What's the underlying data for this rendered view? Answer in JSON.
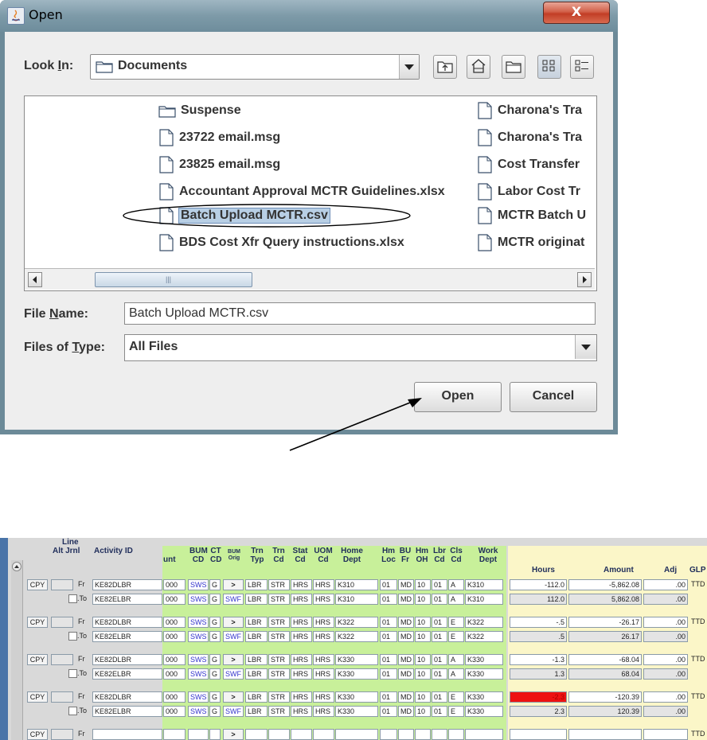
{
  "dialog": {
    "title": "Open",
    "close_label": "X",
    "look_in_label_pre": "Look ",
    "look_in_label_u": "I",
    "look_in_label_post": "n:",
    "look_in_value": "Documents",
    "files_left": [
      "Suspense",
      "23722 email.msg",
      "23825 email.msg",
      "Accountant Approval MCTR Guidelines.xlsx",
      "Batch Upload MCTR.csv",
      "BDS Cost Xfr Query instructions.xlsx"
    ],
    "files_right": [
      "Charona's Tra",
      "Charona's Tra",
      "Cost Transfer",
      "Labor Cost Tr",
      "MCTR Batch U",
      "MCTR originat"
    ],
    "file_name_label_pre": "File ",
    "file_name_label_u": "N",
    "file_name_label_post": "ame:",
    "file_name_value": "Batch Upload MCTR.csv",
    "files_type_label_pre": "Files of ",
    "files_type_label_u": "T",
    "files_type_label_post": "ype:",
    "files_type_value": "All Files",
    "open_label": "Open",
    "cancel_label": "Cancel",
    "scroll_thumb_mark": "|||"
  },
  "grid": {
    "headers": {
      "line": "Line",
      "alt_jrnl": "Alt Jrnl",
      "activity_id": "Activity ID",
      "unt": "unt",
      "bum_cd": [
        "BUM",
        "CD"
      ],
      "ct_cd": [
        "CT",
        "CD"
      ],
      "bum_orig": [
        "BUM",
        "Orig"
      ],
      "trn_typ": [
        "Trn",
        "Typ"
      ],
      "trn_cd": [
        "Trn",
        "Cd"
      ],
      "stat_cd": [
        "Stat",
        "Cd"
      ],
      "uom_cd": [
        "UOM",
        "Cd"
      ],
      "home_dept": [
        "Home",
        "Dept"
      ],
      "hm_loc": [
        "Hm",
        "Loc"
      ],
      "bu_fr": [
        "BU",
        "Fr"
      ],
      "hm_oh": [
        "Hm",
        "OH"
      ],
      "lbr_cd": [
        "Lbr",
        "Cd"
      ],
      "cls_cd": [
        "Cls",
        "Cd"
      ],
      "work_dept": [
        "Work",
        "Dept"
      ],
      "hours": "Hours",
      "amount": "Amount",
      "adj": "Adj",
      "glp": "GLP"
    },
    "cpy_label": "CPY",
    "fr_label": "Fr",
    "to_label": ".To",
    "btn_arrow": ">",
    "rows": [
      {
        "activity": "KE82DLBR",
        "unt": "000",
        "bum": "SWS",
        "ct": "G",
        "orig": ">",
        "typ": "LBR",
        "trn": "STR",
        "stat": "HRS",
        "uom": "HRS",
        "home": "K310",
        "loc": "01",
        "bu": "MD",
        "oh": "10",
        "lbr": "01",
        "cls": "A",
        "work": "K310",
        "hours": "-112.0",
        "amount": "-5,862.08",
        "adj": ".00",
        "glp": "TTD"
      },
      {
        "activity": "KE82ELBR",
        "unt": "000",
        "bum": "SWS",
        "ct": "G",
        "orig": "SWF",
        "typ": "LBR",
        "trn": "STR",
        "stat": "HRS",
        "uom": "HRS",
        "home": "K310",
        "loc": "01",
        "bu": "MD",
        "oh": "10",
        "lbr": "01",
        "cls": "A",
        "work": "K310",
        "hours": "112.0",
        "amount": "5,862.08",
        "adj": ".00",
        "glp": ""
      },
      {
        "activity": "KE82DLBR",
        "unt": "000",
        "bum": "SWS",
        "ct": "G",
        "orig": ">",
        "typ": "LBR",
        "trn": "STR",
        "stat": "HRS",
        "uom": "HRS",
        "home": "K322",
        "loc": "01",
        "bu": "MD",
        "oh": "10",
        "lbr": "01",
        "cls": "E",
        "work": "K322",
        "hours": "-.5",
        "amount": "-26.17",
        "adj": ".00",
        "glp": "TTD"
      },
      {
        "activity": "KE82ELBR",
        "unt": "000",
        "bum": "SWS",
        "ct": "G",
        "orig": "SWF",
        "typ": "LBR",
        "trn": "STR",
        "stat": "HRS",
        "uom": "HRS",
        "home": "K322",
        "loc": "01",
        "bu": "MD",
        "oh": "10",
        "lbr": "01",
        "cls": "E",
        "work": "K322",
        "hours": ".5",
        "amount": "26.17",
        "adj": ".00",
        "glp": ""
      },
      {
        "activity": "KE82DLBR",
        "unt": "000",
        "bum": "SWS",
        "ct": "G",
        "orig": ">",
        "typ": "LBR",
        "trn": "STR",
        "stat": "HRS",
        "uom": "HRS",
        "home": "K330",
        "loc": "01",
        "bu": "MD",
        "oh": "10",
        "lbr": "01",
        "cls": "A",
        "work": "K330",
        "hours": "-1.3",
        "amount": "-68.04",
        "adj": ".00",
        "glp": "TTD"
      },
      {
        "activity": "KE82ELBR",
        "unt": "000",
        "bum": "SWS",
        "ct": "G",
        "orig": "SWF",
        "typ": "LBR",
        "trn": "STR",
        "stat": "HRS",
        "uom": "HRS",
        "home": "K330",
        "loc": "01",
        "bu": "MD",
        "oh": "10",
        "lbr": "01",
        "cls": "A",
        "work": "K330",
        "hours": "1.3",
        "amount": "68.04",
        "adj": ".00",
        "glp": ""
      },
      {
        "activity": "KE82DLBR",
        "unt": "000",
        "bum": "SWS",
        "ct": "G",
        "orig": ">",
        "typ": "LBR",
        "trn": "STR",
        "stat": "HRS",
        "uom": "HRS",
        "home": "K330",
        "loc": "01",
        "bu": "MD",
        "oh": "10",
        "lbr": "01",
        "cls": "E",
        "work": "K330",
        "hours": "-2.3",
        "amount": "-120.39",
        "adj": ".00",
        "glp": "TTD",
        "hours_alert": true
      },
      {
        "activity": "KE82ELBR",
        "unt": "000",
        "bum": "SWS",
        "ct": "G",
        "orig": "SWF",
        "typ": "LBR",
        "trn": "STR",
        "stat": "HRS",
        "uom": "HRS",
        "home": "K330",
        "loc": "01",
        "bu": "MD",
        "oh": "10",
        "lbr": "01",
        "cls": "E",
        "work": "K330",
        "hours": "2.3",
        "amount": "120.39",
        "adj": ".00",
        "glp": ""
      },
      {
        "activity": "",
        "unt": "",
        "bum": "",
        "ct": "",
        "orig": ">",
        "typ": "",
        "trn": "",
        "stat": "",
        "uom": "",
        "home": "",
        "loc": "",
        "bu": "",
        "oh": "",
        "lbr": "",
        "cls": "",
        "work": "",
        "hours": "",
        "amount": "",
        "adj": "",
        "glp": "TTD"
      }
    ]
  },
  "colors": {
    "green_panel": "#c8f09a",
    "yellow_panel": "#fbf6c8",
    "alert_red": "#ee1111",
    "selection": "#b8cfe5"
  }
}
